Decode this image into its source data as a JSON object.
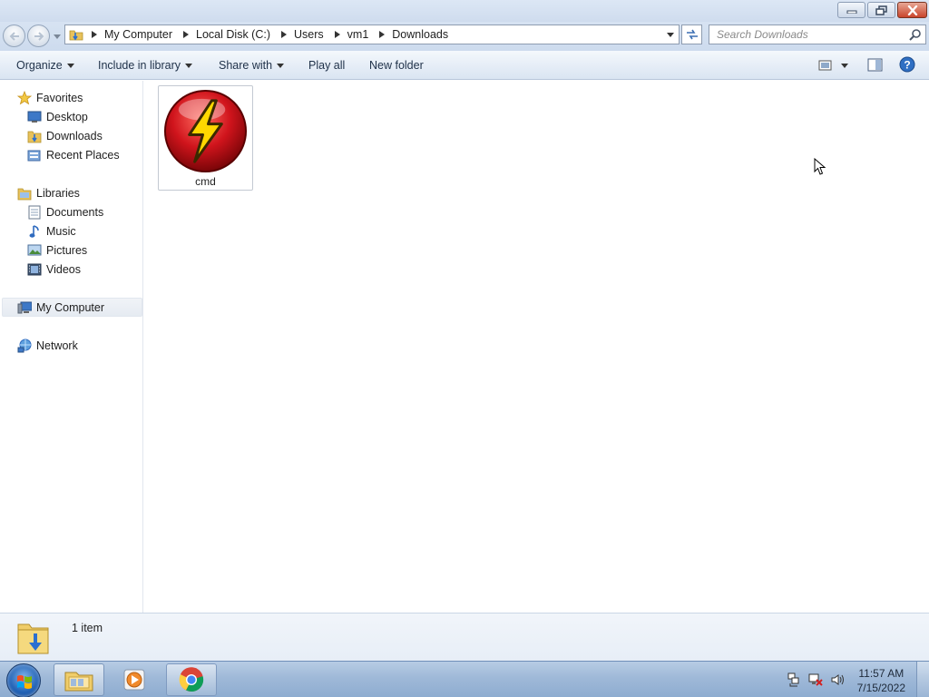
{
  "window": {
    "caption_buttons": [
      "minimize-icon",
      "restore-icon",
      "close-icon"
    ]
  },
  "address_bar": {
    "breadcrumbs": [
      "My Computer",
      "Local Disk (C:)",
      "Users",
      "vm1",
      "Downloads"
    ]
  },
  "search": {
    "placeholder": "Search Downloads"
  },
  "toolbar": {
    "organize": "Organize",
    "include_in_library": "Include in library",
    "share_with": "Share with",
    "play_all": "Play all",
    "new_folder": "New folder"
  },
  "nav": {
    "favorites": {
      "label": "Favorites",
      "items": [
        "Desktop",
        "Downloads",
        "Recent Places"
      ]
    },
    "libraries": {
      "label": "Libraries",
      "items": [
        "Documents",
        "Music",
        "Pictures",
        "Videos"
      ]
    },
    "computer": "My Computer",
    "network": "Network"
  },
  "files": [
    {
      "name": "cmd",
      "icon": "lightning-bolt-icon"
    }
  ],
  "details": {
    "item_count": "1 item"
  },
  "taskbar": {
    "apps": [
      "windows-explorer-icon",
      "media-player-icon",
      "chrome-icon"
    ],
    "clock_time": "11:57 AM",
    "clock_date": "7/15/2022"
  },
  "colors": {
    "accent": "#1f5fb3",
    "icon_red": "#d0141c",
    "bolt_yellow": "#ffd800"
  }
}
